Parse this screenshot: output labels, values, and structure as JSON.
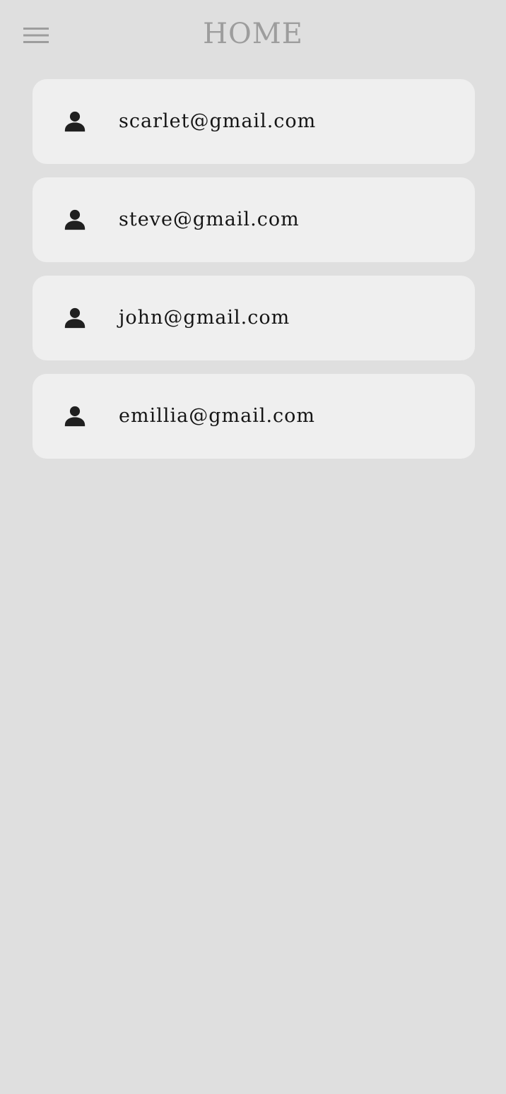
{
  "app_bar": {
    "menu_icon": "menu-icon",
    "title": "HOME"
  },
  "users": [
    {
      "email": "scarlet@gmail.com",
      "icon": "person-icon"
    },
    {
      "email": "steve@gmail.com",
      "icon": "person-icon"
    },
    {
      "email": "john@gmail.com",
      "icon": "person-icon"
    },
    {
      "email": "emillia@gmail.com",
      "icon": "person-icon"
    }
  ],
  "colors": {
    "background": "#dfdfdf",
    "card": "#efefef",
    "title": "#9d9d9d",
    "text": "#151515",
    "icon": "#202020"
  }
}
